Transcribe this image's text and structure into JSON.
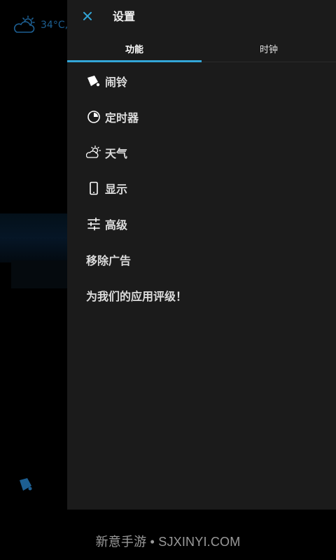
{
  "background": {
    "weather_temp": "34°C,",
    "weather_icon": "cloud-sun-icon",
    "bell_icon": "bell-icon"
  },
  "drawer": {
    "title": "设置",
    "close_icon": "close-icon",
    "tabs": [
      {
        "label": "功能",
        "active": true
      },
      {
        "label": "时钟",
        "active": false
      }
    ],
    "items": [
      {
        "label": "闹铃",
        "icon": "bell-icon"
      },
      {
        "label": "定时器",
        "icon": "timer-icon"
      },
      {
        "label": "天气",
        "icon": "weather-icon"
      },
      {
        "label": "显示",
        "icon": "phone-icon"
      },
      {
        "label": "高级",
        "icon": "sliders-icon"
      },
      {
        "label": "移除广告",
        "icon": ""
      },
      {
        "label": "为我们的应用评级！",
        "icon": ""
      }
    ]
  },
  "watermark": "新意手游 • SJXINYI.COM",
  "colors": {
    "accent": "#33a6d8",
    "drawer_bg": "#1b1b1b",
    "background": "#000000",
    "bg_text": "#1d5f92"
  }
}
